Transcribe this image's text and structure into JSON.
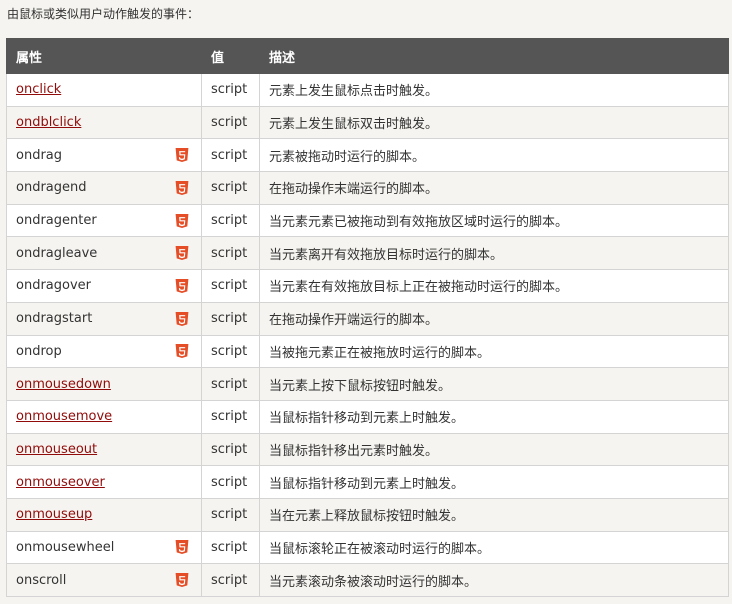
{
  "intro": "由鼠标或类似用户动作触发的事件：",
  "table": {
    "headers": [
      "属性",
      "值",
      "描述"
    ],
    "rows": [
      {
        "attr": "onclick",
        "link": true,
        "html5": false,
        "value": "script",
        "desc": "元素上发生鼠标点击时触发。"
      },
      {
        "attr": "ondblclick",
        "link": true,
        "html5": false,
        "value": "script",
        "desc": "元素上发生鼠标双击时触发。"
      },
      {
        "attr": "ondrag",
        "link": false,
        "html5": true,
        "value": "script",
        "desc": "元素被拖动时运行的脚本。"
      },
      {
        "attr": "ondragend",
        "link": false,
        "html5": true,
        "value": "script",
        "desc": "在拖动操作末端运行的脚本。"
      },
      {
        "attr": "ondragenter",
        "link": false,
        "html5": true,
        "value": "script",
        "desc": "当元素元素已被拖动到有效拖放区域时运行的脚本。"
      },
      {
        "attr": "ondragleave",
        "link": false,
        "html5": true,
        "value": "script",
        "desc": "当元素离开有效拖放目标时运行的脚本。"
      },
      {
        "attr": "ondragover",
        "link": false,
        "html5": true,
        "value": "script",
        "desc": "当元素在有效拖放目标上正在被拖动时运行的脚本。"
      },
      {
        "attr": "ondragstart",
        "link": false,
        "html5": true,
        "value": "script",
        "desc": "在拖动操作开端运行的脚本。"
      },
      {
        "attr": "ondrop",
        "link": false,
        "html5": true,
        "value": "script",
        "desc": "当被拖元素正在被拖放时运行的脚本。"
      },
      {
        "attr": "onmousedown",
        "link": true,
        "html5": false,
        "value": "script",
        "desc": "当元素上按下鼠标按钮时触发。"
      },
      {
        "attr": "onmousemove",
        "link": true,
        "html5": false,
        "value": "script",
        "desc": "当鼠标指针移动到元素上时触发。"
      },
      {
        "attr": "onmouseout",
        "link": true,
        "html5": false,
        "value": "script",
        "desc": "当鼠标指针移出元素时触发。"
      },
      {
        "attr": "onmouseover",
        "link": true,
        "html5": false,
        "value": "script",
        "desc": "当鼠标指针移动到元素上时触发。"
      },
      {
        "attr": "onmouseup",
        "link": true,
        "html5": false,
        "value": "script",
        "desc": "当在元素上释放鼠标按钮时触发。"
      },
      {
        "attr": "onmousewheel",
        "link": false,
        "html5": true,
        "value": "script",
        "desc": "当鼠标滚轮正在被滚动时运行的脚本。"
      },
      {
        "attr": "onscroll",
        "link": false,
        "html5": true,
        "value": "script",
        "desc": "当元素滚动条被滚动时运行的脚本。"
      }
    ]
  },
  "icons": {
    "html5": "html5-icon"
  },
  "colors": {
    "header_bg": "#555555",
    "link": "#900b09",
    "html5_badge": "#e44d26",
    "page_bg": "#f6f4f0"
  }
}
